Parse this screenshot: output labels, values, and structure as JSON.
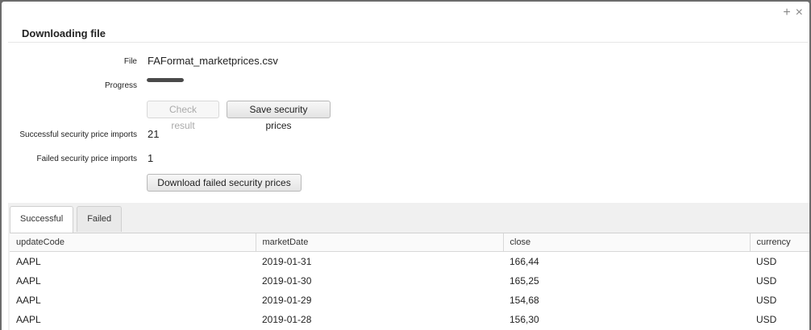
{
  "window": {
    "controls": [
      "+",
      "×"
    ]
  },
  "dialog": {
    "title": "Downloading file"
  },
  "form": {
    "file_label": "File",
    "file_value": "FAFormat_marketprices.csv",
    "progress_label": "Progress",
    "progress_fraction": 1.0,
    "check_result_label": "Check result",
    "save_prices_label": "Save security prices",
    "successful_label": "Successful security price imports",
    "successful_value": "21",
    "failed_label": "Failed security price imports",
    "failed_value": "1",
    "download_failed_label": "Download failed security prices"
  },
  "tabs": [
    {
      "label": "Successful",
      "active": true
    },
    {
      "label": "Failed",
      "active": false
    }
  ],
  "table": {
    "columns": [
      "updateCode",
      "marketDate",
      "close",
      "currency"
    ],
    "rows": [
      [
        "AAPL",
        "2019-01-31",
        "166,44",
        "USD"
      ],
      [
        "AAPL",
        "2019-01-30",
        "165,25",
        "USD"
      ],
      [
        "AAPL",
        "2019-01-29",
        "154,68",
        "USD"
      ],
      [
        "AAPL",
        "2019-01-28",
        "156,30",
        "USD"
      ]
    ]
  }
}
